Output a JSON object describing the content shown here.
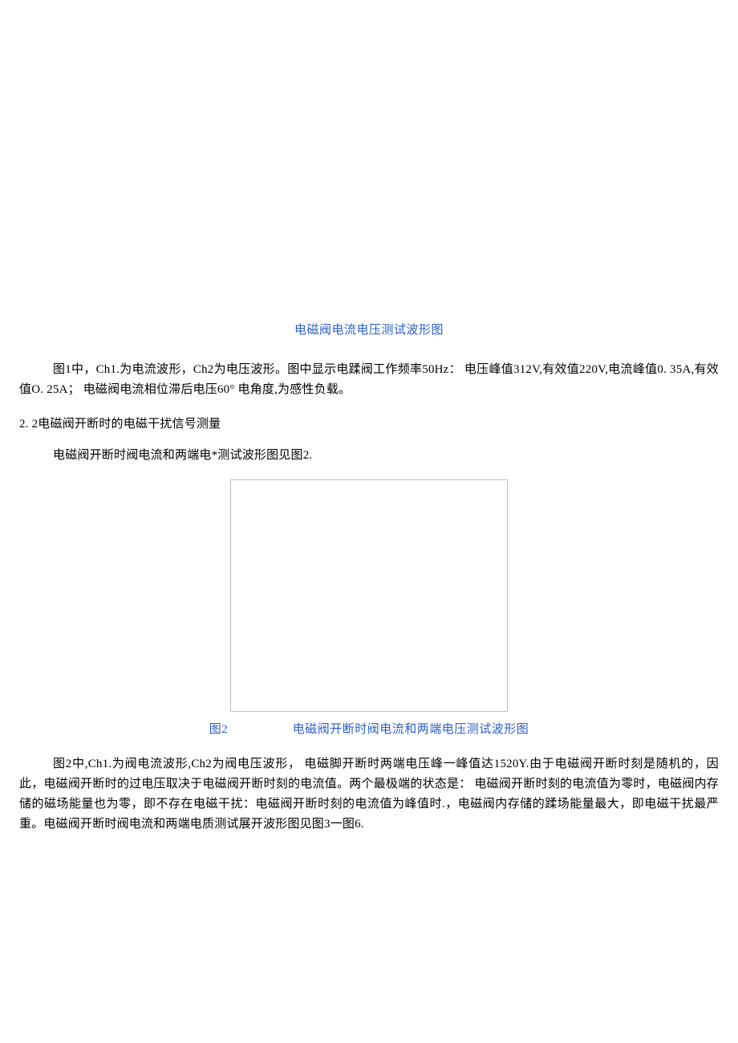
{
  "figure1": {
    "caption": "电磁阀电流电压测试波形图"
  },
  "paragraph1": "图1中，Ch1.为电流波形，Ch2为电压波形。图中显示电蹂阀工作频率50Hz： 电压峰值312V,有效值220V,电流峰值0. 35A,有效值O. 25A； 电磁阀电流相位滞后电压60° 电角度,为感性负载。",
  "section2_2": "2. 2电磁阀开断时的电磁干扰信号测量",
  "paragraph2": "电磁阀开断时阀电流和两端电*测试波形图见图2.",
  "figure2": {
    "label": "图2",
    "title": "电磁阀开断时阀电流和两端电压测试波形图"
  },
  "paragraph3": "图2中,Ch1.为阀电流波形,Ch2为阀电压波形， 电磁脚开断时两端电压峰一峰值达1520Y.由于电磁阀开断时刻是随机的，因此，电磁阀开断时的过电压取决于电磁阀开断时刻的电流值。两个最极端的状态是： 电磁阀开断时刻的电流值为零时，电磁阀内存储的磁场能量也为零，即不存在电磁干扰：电磁阀开断时刻的电流值为峰值时.，电磁阀内存储的蹂场能量最大，即电磁干扰最严重。电磁阀开断时阀电流和两端电质测试展开波形图见图3一图6."
}
